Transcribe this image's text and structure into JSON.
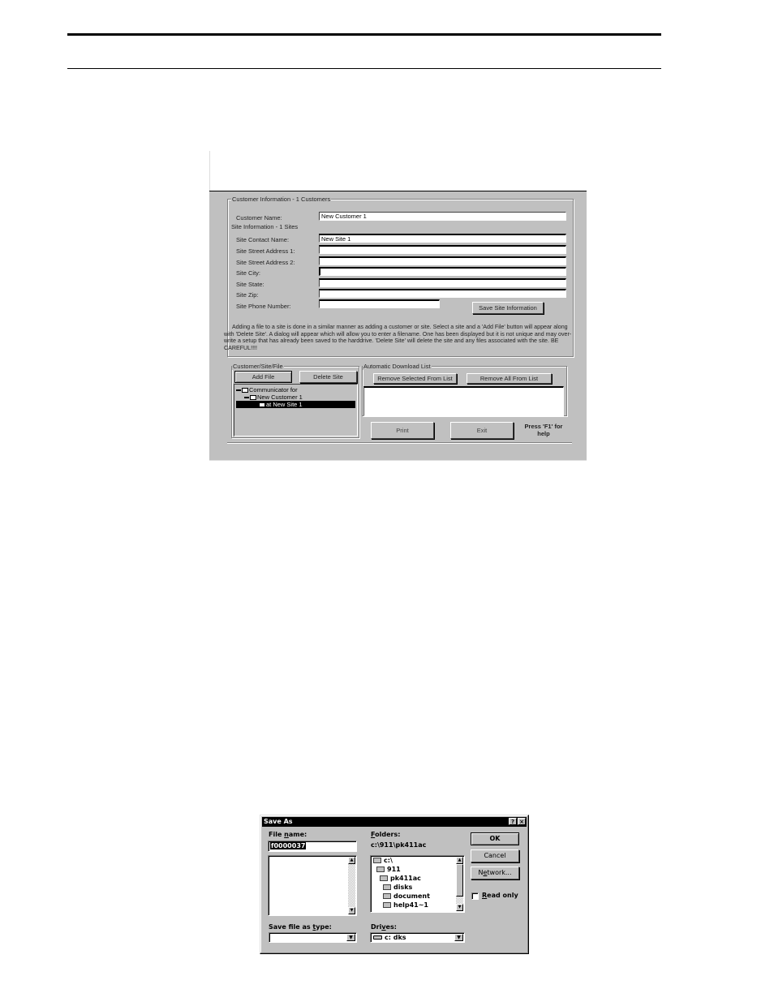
{
  "app_window": {
    "customer_group": {
      "title": "Customer Information - 1 Customers",
      "customer_name_label": "Customer Name:",
      "customer_name_value": "New Customer 1"
    },
    "site_group": {
      "title": "Site Information - 1 Sites",
      "fields": [
        {
          "label": "Site Contact Name:",
          "value": "New Site 1"
        },
        {
          "label": "Site Street Address 1:",
          "value": ""
        },
        {
          "label": "Site Street Address 2:",
          "value": ""
        },
        {
          "label": "Site City:",
          "value": ""
        },
        {
          "label": "Site State:",
          "value": ""
        },
        {
          "label": "Site Zip:",
          "value": ""
        },
        {
          "label": "Site Phone Number:",
          "value": ""
        }
      ],
      "save_button": "Save Site Information"
    },
    "instructions": "Adding a file to a site is done in a similar manner as adding a customer or site. Select a site and a 'Add File' button will appear along with 'Delete Site'. A dialog will appear which will allow you to enter a filename. One has been displayed but it is not unique and may over-write a setup that has already been saved to the harddrive. 'Delete Site' will delete the site and any files associated with the site. BE CAREFUL!!!!",
    "tree_group": {
      "title": "Customer/Site/File",
      "add_file_button": "Add File",
      "delete_site_button": "Delete Site",
      "nodes": [
        {
          "label": "Communicator for",
          "level": 0,
          "selected": false
        },
        {
          "label": "New Customer 1",
          "level": 1,
          "selected": false
        },
        {
          "label": "at New Site 1",
          "level": 2,
          "selected": true
        }
      ]
    },
    "download_group": {
      "title": "Automatic Download List",
      "remove_selected_button": "Remove Selected From List",
      "remove_all_button": "Remove All From List",
      "items": []
    },
    "print_button": "Print",
    "exit_button": "Exit",
    "help_text_line1": "Press 'F1' for",
    "help_text_line2": "help"
  },
  "save_as_dialog": {
    "title": "Save As",
    "help_button": "?",
    "close_button": "×",
    "file_name_label_pre": "File ",
    "file_name_label_u": "n",
    "file_name_label_post": "ame:",
    "file_name_value": "f0000037",
    "folders_label_u": "F",
    "folders_label_post": "olders:",
    "current_path": "c:\\911\\pk411ac",
    "folders": [
      "c:\\",
      "911",
      "pk411ac",
      "disks",
      "document",
      "help41~1"
    ],
    "save_type_label_pre": "Save file as ",
    "save_type_label_u": "t",
    "save_type_label_post": "ype:",
    "save_type_value": "",
    "drives_label_pre": "Dri",
    "drives_label_u": "v",
    "drives_label_post": "es:",
    "drive_value": "c: dks",
    "ok_button": "OK",
    "cancel_button": "Cancel",
    "network_button_pre": "N",
    "network_button_u": "e",
    "network_button_post": "twork...",
    "read_only_label_u": "R",
    "read_only_label_post": "ead only",
    "read_only_checked": false
  }
}
